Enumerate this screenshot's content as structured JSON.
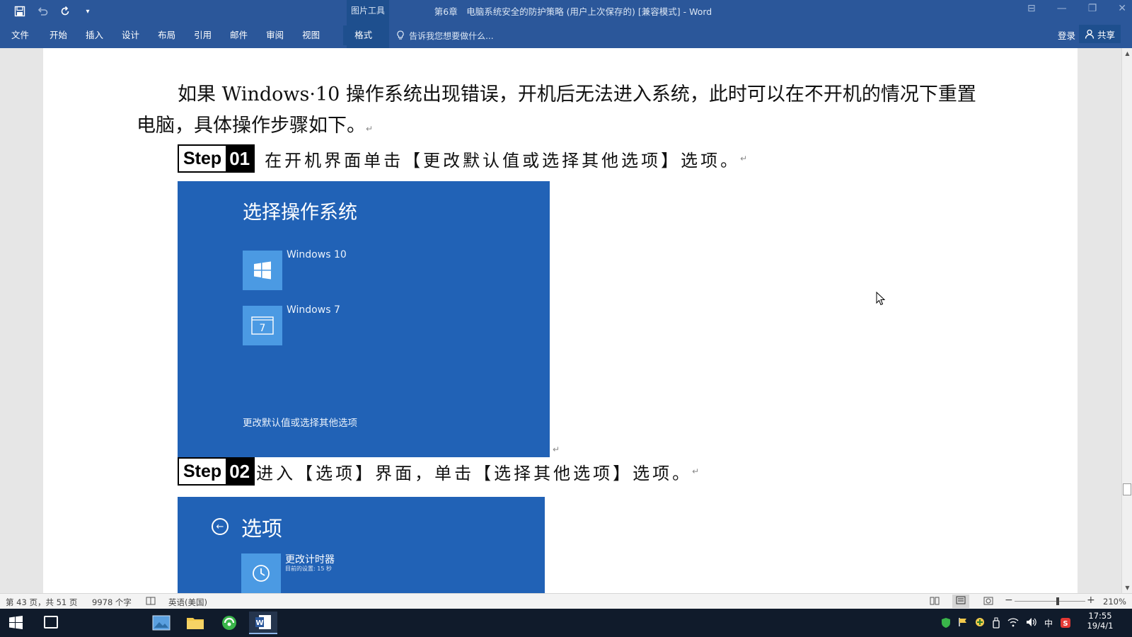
{
  "titlebar": {
    "title": "第6章　电脑系统安全的防护策略 (用户上次保存的) [兼容模式] - Word",
    "context_tab_group": "图片工具",
    "qat": {
      "save": "save-icon",
      "undo": "undo-icon",
      "redo": "repeat-icon",
      "customize": "▾"
    }
  },
  "ribbon": {
    "tabs": [
      {
        "label": "文件"
      },
      {
        "label": "开始"
      },
      {
        "label": "插入"
      },
      {
        "label": "设计"
      },
      {
        "label": "布局"
      },
      {
        "label": "引用"
      },
      {
        "label": "邮件"
      },
      {
        "label": "审阅"
      },
      {
        "label": "视图"
      },
      {
        "label": "格式"
      }
    ],
    "active_tab": "格式",
    "tell_me": "告诉我您想要做什么...",
    "sign_in": "登录",
    "share": "共享"
  },
  "document": {
    "intro": "如果 Windows·10 操作系统出现错误，开机后无法进入系统，此时可以在不开机的情况下重置电脑，具体操作步骤如下。",
    "paragraph_mark": "↵",
    "steps": [
      {
        "word": "Step",
        "num": "01",
        "text": "在开机界面单击【更改默认值或选择其他选项】选项。"
      },
      {
        "word": "Step",
        "num": "02",
        "text": "进入【选项】界面，单击【选择其他选项】选项。"
      }
    ],
    "screenshot1": {
      "title": "选择操作系统",
      "items": [
        {
          "label": "Windows 10"
        },
        {
          "label": "Windows 7"
        }
      ],
      "footer": "更改默认值或选择其他选项"
    },
    "screenshot2": {
      "title": "选项",
      "item_title": "更改计时器",
      "item_sub": "目前的设置: 15 秒"
    }
  },
  "statusbar": {
    "page": "第 43 页，共 51 页",
    "words": "9978 个字",
    "language": "英语(美国)",
    "zoom": "210%"
  },
  "taskbar": {
    "time": "17:55",
    "date": "19/4/1",
    "ime": "中"
  }
}
